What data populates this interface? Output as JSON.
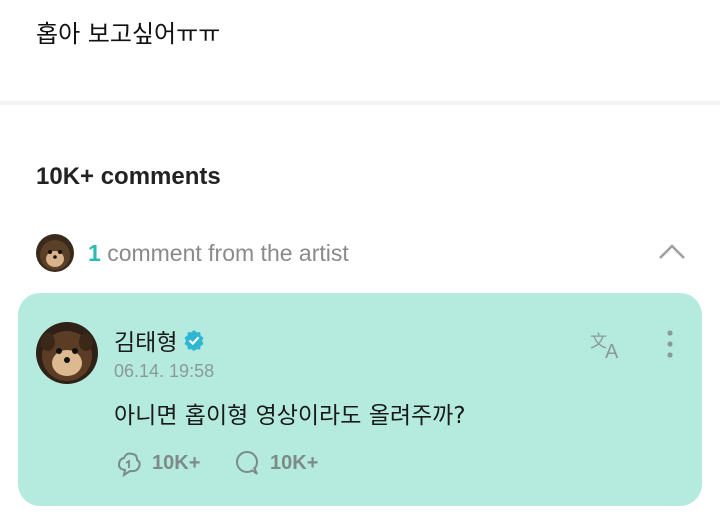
{
  "post": {
    "text": "홉아 보고싶어ㅠㅠ"
  },
  "comments": {
    "count_label": "10K+ comments",
    "artist_summary": {
      "count": "1",
      "label": "comment from the artist"
    }
  },
  "artist_comment": {
    "author": "김태형",
    "timestamp": "06.14. 19:58",
    "text": "아니면 홉이형 영상이라도 올려주까?",
    "likes": "10K+",
    "replies": "10K+"
  },
  "icons": {
    "verified": "verified-badge-icon",
    "translate": "translate-icon",
    "more": "more-vertical-icon",
    "like": "like-icon",
    "reply": "reply-icon",
    "chevron": "chevron-up-icon"
  },
  "colors": {
    "accent": "#2bbbb0",
    "card_bg": "#b5eadf"
  }
}
